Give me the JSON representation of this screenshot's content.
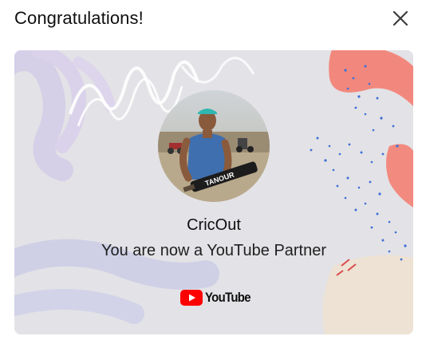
{
  "dialog": {
    "title": "Congratulations!"
  },
  "card": {
    "channel_name": "CricOut",
    "message": "You are now a YouTube Partner",
    "logo_text": "YouTube",
    "avatar_bat_text": "TANOUR"
  },
  "colors": {
    "card_bg": "#e3e2e6",
    "accent_red": "#ff0000",
    "coral": "#f2857a",
    "blue_dots": "#3d6fd8",
    "lavender": "#d7d0ea"
  }
}
